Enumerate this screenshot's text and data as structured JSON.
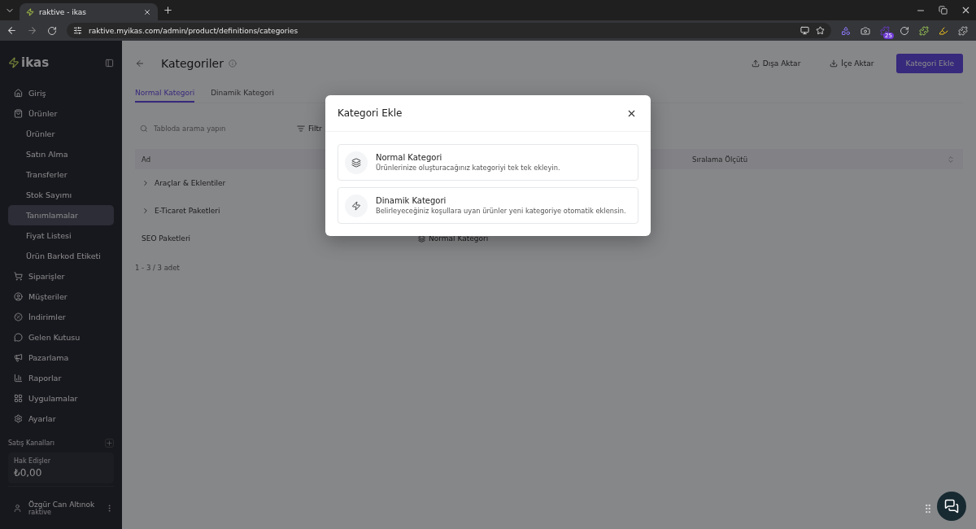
{
  "browser": {
    "tab_title": "raktive - ikas",
    "url": "raktive.myikas.com/admin/product/definitions/categories",
    "extension_badge": "25"
  },
  "sidebar": {
    "logo": "ikas",
    "items": [
      {
        "label": "Giriş",
        "selected": false
      },
      {
        "label": "Ürünler",
        "selected": false,
        "children": [
          {
            "label": "Ürünler",
            "selected": false
          },
          {
            "label": "Satın Alma",
            "selected": false
          },
          {
            "label": "Transferler",
            "selected": false
          },
          {
            "label": "Stok Sayımı",
            "selected": false
          },
          {
            "label": "Tanımlamalar",
            "selected": true
          },
          {
            "label": "Fiyat Listesi",
            "selected": false
          },
          {
            "label": "Ürün Barkod Etiketi",
            "selected": false
          }
        ]
      },
      {
        "label": "Siparişler",
        "selected": false
      },
      {
        "label": "Müşteriler",
        "selected": false
      },
      {
        "label": "İndirimler",
        "selected": false
      },
      {
        "label": "Gelen Kutusu",
        "selected": false
      },
      {
        "label": "Pazarlama",
        "selected": false
      },
      {
        "label": "Raporlar",
        "selected": false
      },
      {
        "label": "Uygulamalar",
        "selected": false
      },
      {
        "label": "Ayarlar",
        "selected": false
      }
    ],
    "section_title": "Satış Kanalları",
    "earnings": {
      "label": "Hak Edişler",
      "value": "₺0,00"
    },
    "user": {
      "name": "Özgür Can Altınok",
      "store": "raktive"
    }
  },
  "page": {
    "title": "Kategoriler",
    "actions": [
      "Dışa Aktar",
      "İçe Aktar"
    ],
    "primary_action": "Kategori Ekle",
    "tabs": [
      {
        "label": "Normal Kategori",
        "selected": true
      },
      {
        "label": "Dinamik Kategori",
        "selected": false
      }
    ],
    "search": {
      "placeholder": "Tabloda arama yapın"
    },
    "filter": "Filtr",
    "table": {
      "columns": [
        "Ad",
        "Sıralama Ölçütü"
      ],
      "rows": [
        {
          "name": "Araçlar & Eklentiler",
          "has_children": true
        },
        {
          "name": "E-Ticaret Paketleri",
          "has_children": true
        },
        {
          "name": "SEO Paketleri",
          "has_children": false,
          "type": "Normal Kategori"
        }
      ]
    },
    "pagination": "1 - 3 / 3 adet"
  },
  "modal": {
    "title": "Kategori Ekle",
    "options": [
      {
        "title": "Normal Kategori",
        "description": "Ürünlerinize oluşturacağınız kategoriyi tek tek ekleyin."
      },
      {
        "title": "Dinamik Kategori",
        "description": "Belirleyeceğiniz koşullara uyan ürünler yeni kategoriye otomatik eklensin."
      }
    ]
  }
}
